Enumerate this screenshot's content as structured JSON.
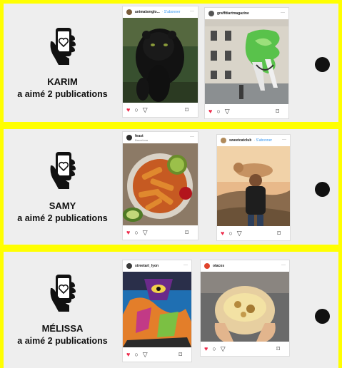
{
  "rows": [
    {
      "name": "KARIM",
      "liked": "a aimé 2 publications",
      "posts": [
        {
          "user": "animalsmglo...",
          "follow": "· S'abonner",
          "sub": "",
          "image": "black-panther-photo"
        },
        {
          "user": "graffitiartmagazine",
          "follow": "",
          "sub": "",
          "image": "street-art-wall-photo"
        }
      ]
    },
    {
      "name": "SAMY",
      "liked": "a aimé 2 publications",
      "posts": [
        {
          "user": "feast",
          "follow": "",
          "sub": "Barcelona",
          "image": "potato-wedges-food-photo"
        },
        {
          "user": "sweetcatclub",
          "follow": "· S'abonner",
          "sub": "",
          "image": "man-carrying-dog-photo"
        }
      ]
    },
    {
      "name": "MÉLISSA",
      "liked": "a aimé 2 publications",
      "posts": [
        {
          "user": "streetart_lyon",
          "follow": "",
          "sub": "",
          "image": "graffiti-mural-photo"
        },
        {
          "user": "otacos",
          "follow": "",
          "sub": "",
          "image": "tacos-burrito-photo"
        }
      ]
    }
  ],
  "icons": {
    "phone": "hand-phone-heart-icon",
    "like": "heart-icon",
    "comment": "comment-icon",
    "share": "share-icon",
    "save": "bookmark-icon",
    "more": "more-dots-icon",
    "indicator": "black-dot"
  },
  "colors": {
    "frame": "#ffff00",
    "panel": "#eeeeee",
    "heart": "#ed2a4a",
    "follow_link": "#3897f0"
  },
  "glyphs": {
    "dots": "···",
    "heart": "♥",
    "comment": "○",
    "share": "▽",
    "save": "⌑"
  }
}
